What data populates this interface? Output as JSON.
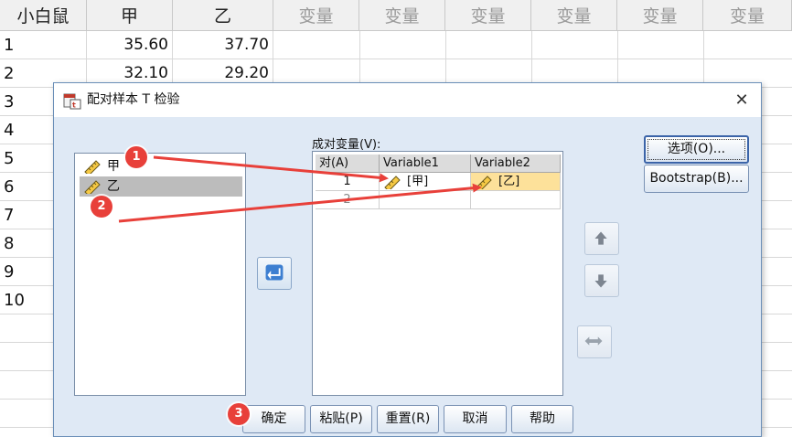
{
  "sheet": {
    "headers": [
      "小白鼠",
      "甲",
      "乙",
      "变量",
      "变量",
      "变量",
      "变量",
      "变量",
      "变量"
    ],
    "rows": [
      {
        "num": "1",
        "a": "35.60",
        "b": "37.70"
      },
      {
        "num": "2",
        "a": "32.10",
        "b": "29.20"
      },
      {
        "num": "3"
      },
      {
        "num": "4"
      },
      {
        "num": "5"
      },
      {
        "num": "6"
      },
      {
        "num": "7"
      },
      {
        "num": "8"
      },
      {
        "num": "9"
      },
      {
        "num": "10"
      }
    ]
  },
  "dialog": {
    "title": "配对样本 T 检验",
    "close_glyph": "✕",
    "source_items": [
      "甲",
      "乙"
    ],
    "pairs_label": "成对变量(V):",
    "table_headers": [
      "对(A)",
      "Variable1",
      "Variable2"
    ],
    "pairs": [
      {
        "idx": "1",
        "v1": "[甲]",
        "v2": "[乙]"
      },
      {
        "idx": "2",
        "v1": "",
        "v2": ""
      }
    ],
    "buttons": {
      "options": "选项(O)...",
      "bootstrap": "Bootstrap(B)...",
      "ok": "确定",
      "paste": "粘贴(P)",
      "reset": "重置(R)",
      "cancel": "取消",
      "help": "帮助"
    }
  },
  "annotations": {
    "badges": [
      "1",
      "2",
      "3"
    ],
    "color": "#e8403a"
  },
  "colors": {
    "accent": "#3b64a8",
    "highlight": "#fde19a",
    "dialog_bg": "#dfe9f5"
  }
}
